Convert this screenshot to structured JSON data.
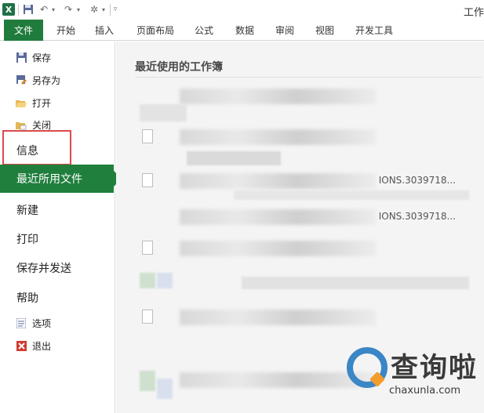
{
  "window": {
    "title": "工作"
  },
  "quick_access": {
    "icons": [
      "excel-logo",
      "save-icon",
      "undo-icon",
      "redo-icon",
      "tools-icon",
      "customize-icon"
    ],
    "logo_letter": "X"
  },
  "ribbon": {
    "file_tab": "文件",
    "tabs": [
      "开始",
      "插入",
      "页面布局",
      "公式",
      "数据",
      "审阅",
      "视图",
      "开发工具"
    ]
  },
  "backstage": {
    "commands": [
      {
        "label": "保存",
        "icon": "save-icon"
      },
      {
        "label": "另存为",
        "icon": "save-as-icon"
      },
      {
        "label": "打开",
        "icon": "folder-open-icon"
      },
      {
        "label": "关闭",
        "icon": "close-file-icon"
      }
    ],
    "info": "信息",
    "recent": "最近所用文件",
    "new": "新建",
    "print": "打印",
    "save_send": "保存并发送",
    "help": "帮助",
    "options": "选项",
    "exit": "退出"
  },
  "recent_panel": {
    "title": "最近使用的工作簿",
    "rows": [
      {
        "path": ""
      },
      {
        "path": ""
      },
      {
        "path": "IONS.3039718..."
      },
      {
        "path": "IONS.3039718..."
      },
      {
        "path": ""
      },
      {
        "path": ""
      },
      {
        "path": ""
      }
    ]
  },
  "watermark": {
    "name": "查询啦",
    "url": "chaxunla.com"
  },
  "colors": {
    "accent": "#207f3d",
    "highlight": "#d94a4a",
    "watermark_blue": "#3a86c6",
    "watermark_orange": "#f39c2b"
  }
}
